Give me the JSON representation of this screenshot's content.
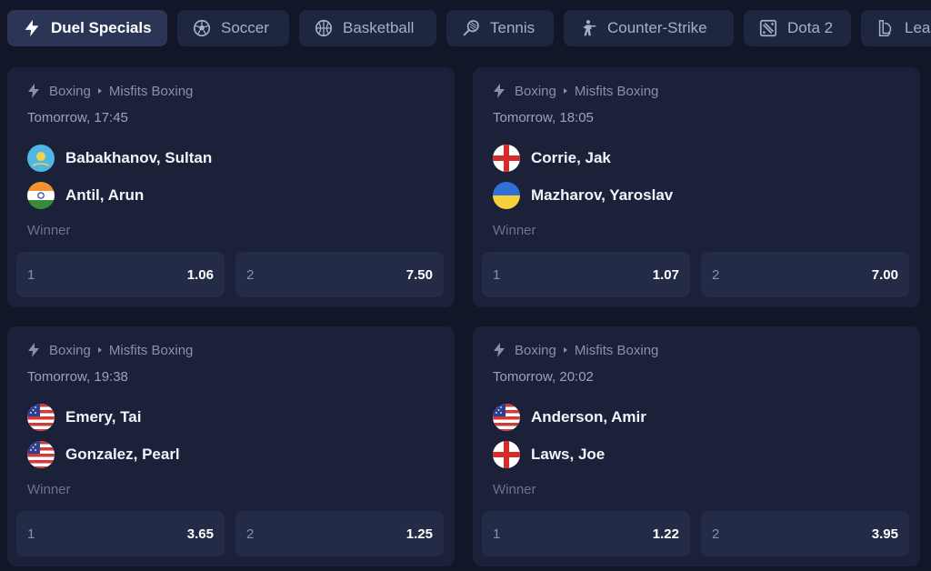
{
  "tabs": [
    {
      "label": "Duel Specials",
      "icon": "bolt-icon",
      "active": true
    },
    {
      "label": "Soccer",
      "icon": "soccer-ball-icon"
    },
    {
      "label": "Basketball",
      "icon": "basketball-icon"
    },
    {
      "label": "Tennis",
      "icon": "tennis-racket-icon"
    },
    {
      "label": "Counter-Strike",
      "icon": "soldier-icon"
    },
    {
      "label": "Dota 2",
      "icon": "dota-icon"
    },
    {
      "label": "Lea",
      "icon": "league-icon"
    }
  ],
  "cards": [
    {
      "sport": "Boxing",
      "league": "Misfits Boxing",
      "time": "Tomorrow, 17:45",
      "players": [
        {
          "name": "Babakhanov, Sultan",
          "flag": "kazakhstan-flag-icon"
        },
        {
          "name": "Antil, Arun",
          "flag": "india-flag-icon"
        }
      ],
      "market": "Winner",
      "odds": [
        {
          "label": "1",
          "value": "1.06"
        },
        {
          "label": "2",
          "value": "7.50"
        }
      ]
    },
    {
      "sport": "Boxing",
      "league": "Misfits Boxing",
      "time": "Tomorrow, 18:05",
      "players": [
        {
          "name": "Corrie, Jak",
          "flag": "england-flag-icon"
        },
        {
          "name": "Mazharov, Yaroslav",
          "flag": "ukraine-flag-icon"
        }
      ],
      "market": "Winner",
      "odds": [
        {
          "label": "1",
          "value": "1.07"
        },
        {
          "label": "2",
          "value": "7.00"
        }
      ]
    },
    {
      "sport": "Boxing",
      "league": "Misfits Boxing",
      "time": "Tomorrow, 19:38",
      "players": [
        {
          "name": "Emery, Tai",
          "flag": "usa-flag-icon"
        },
        {
          "name": "Gonzalez, Pearl",
          "flag": "usa-flag-icon"
        }
      ],
      "market": "Winner",
      "odds": [
        {
          "label": "1",
          "value": "3.65"
        },
        {
          "label": "2",
          "value": "1.25"
        }
      ]
    },
    {
      "sport": "Boxing",
      "league": "Misfits Boxing",
      "time": "Tomorrow, 20:02",
      "players": [
        {
          "name": "Anderson, Amir",
          "flag": "usa-flag-icon"
        },
        {
          "name": "Laws, Joe",
          "flag": "england-flag-icon"
        }
      ],
      "market": "Winner",
      "odds": [
        {
          "label": "1",
          "value": "1.22"
        },
        {
          "label": "2",
          "value": "3.95"
        }
      ]
    }
  ],
  "colors": {
    "background": "#111628",
    "card": "#1b2139",
    "odd_button": "#242b46",
    "tab": "#1f2640",
    "tab_active": "#2c3556"
  }
}
